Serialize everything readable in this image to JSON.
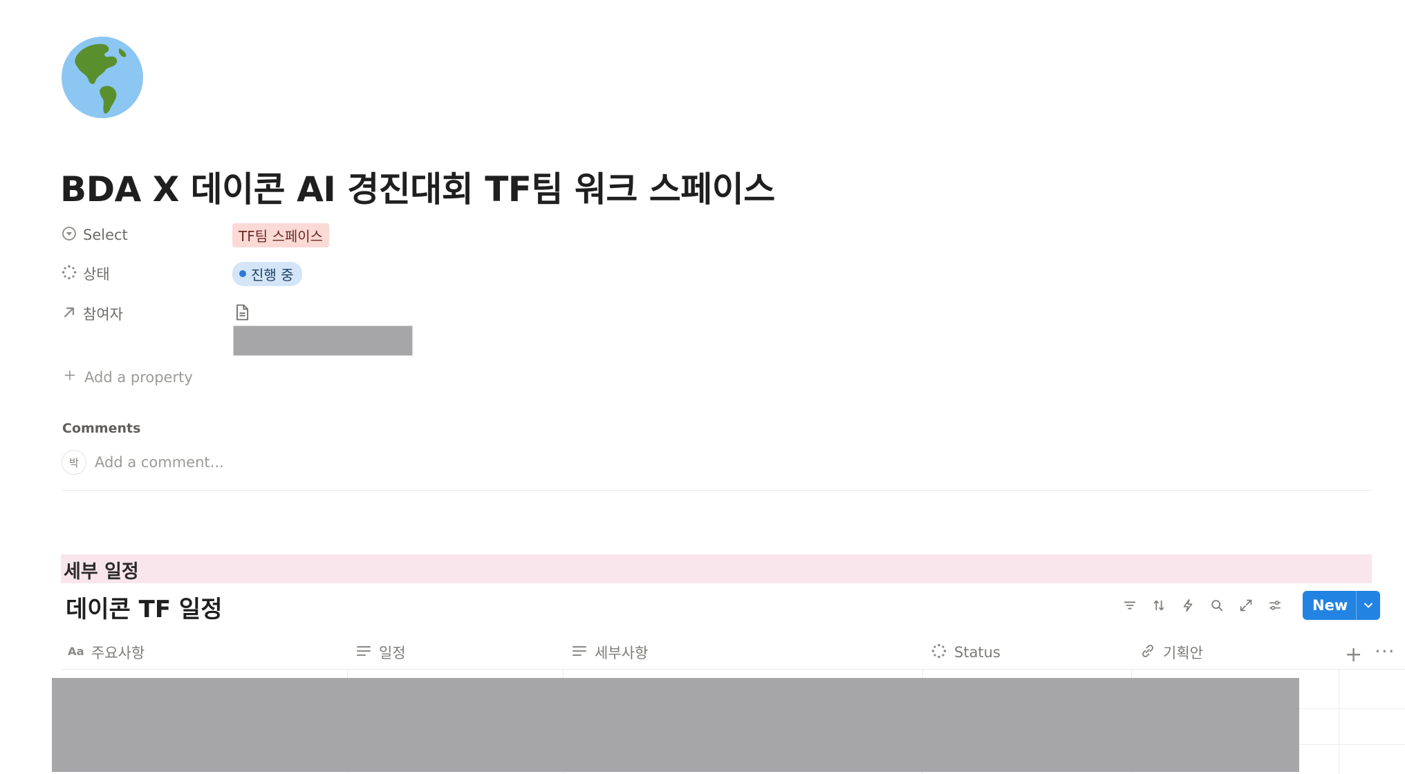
{
  "page": {
    "icon": "earth-globe-icon",
    "title": "BDA X 데이콘 AI 경진대회 TF팀 워크 스페이스"
  },
  "properties": [
    {
      "icon": "select-icon",
      "name": "Select",
      "value": "TF팀 스페이스",
      "color": "#fbd9d5"
    },
    {
      "icon": "status-icon",
      "name": "상태",
      "value": "진행 중",
      "color": "#d3e5f7"
    },
    {
      "icon": "relation-arrow-icon",
      "name": "참여자",
      "value_icon": "document-icon"
    }
  ],
  "add_property_label": "Add a property",
  "comments": {
    "label": "Comments",
    "avatar_initial": "박",
    "placeholder": "Add a comment..."
  },
  "section": {
    "heading": "세부 일정",
    "background": "#f9e6ed"
  },
  "database": {
    "title": "데이콘 TF 일정",
    "toolbar": [
      "filter-icon",
      "sort-icon",
      "automation-icon",
      "search-icon",
      "expand-icon",
      "settings-icon"
    ],
    "new_button_label": "New",
    "accent": "#2383e2",
    "columns": [
      {
        "icon": "title-icon",
        "name": "주요사항"
      },
      {
        "icon": "text-icon",
        "name": "일정"
      },
      {
        "icon": "text-icon",
        "name": "세부사항"
      },
      {
        "icon": "status-icon",
        "name": "Status"
      },
      {
        "icon": "link-icon",
        "name": "기획안"
      }
    ],
    "add_column_label": "+",
    "more_label": "···"
  }
}
